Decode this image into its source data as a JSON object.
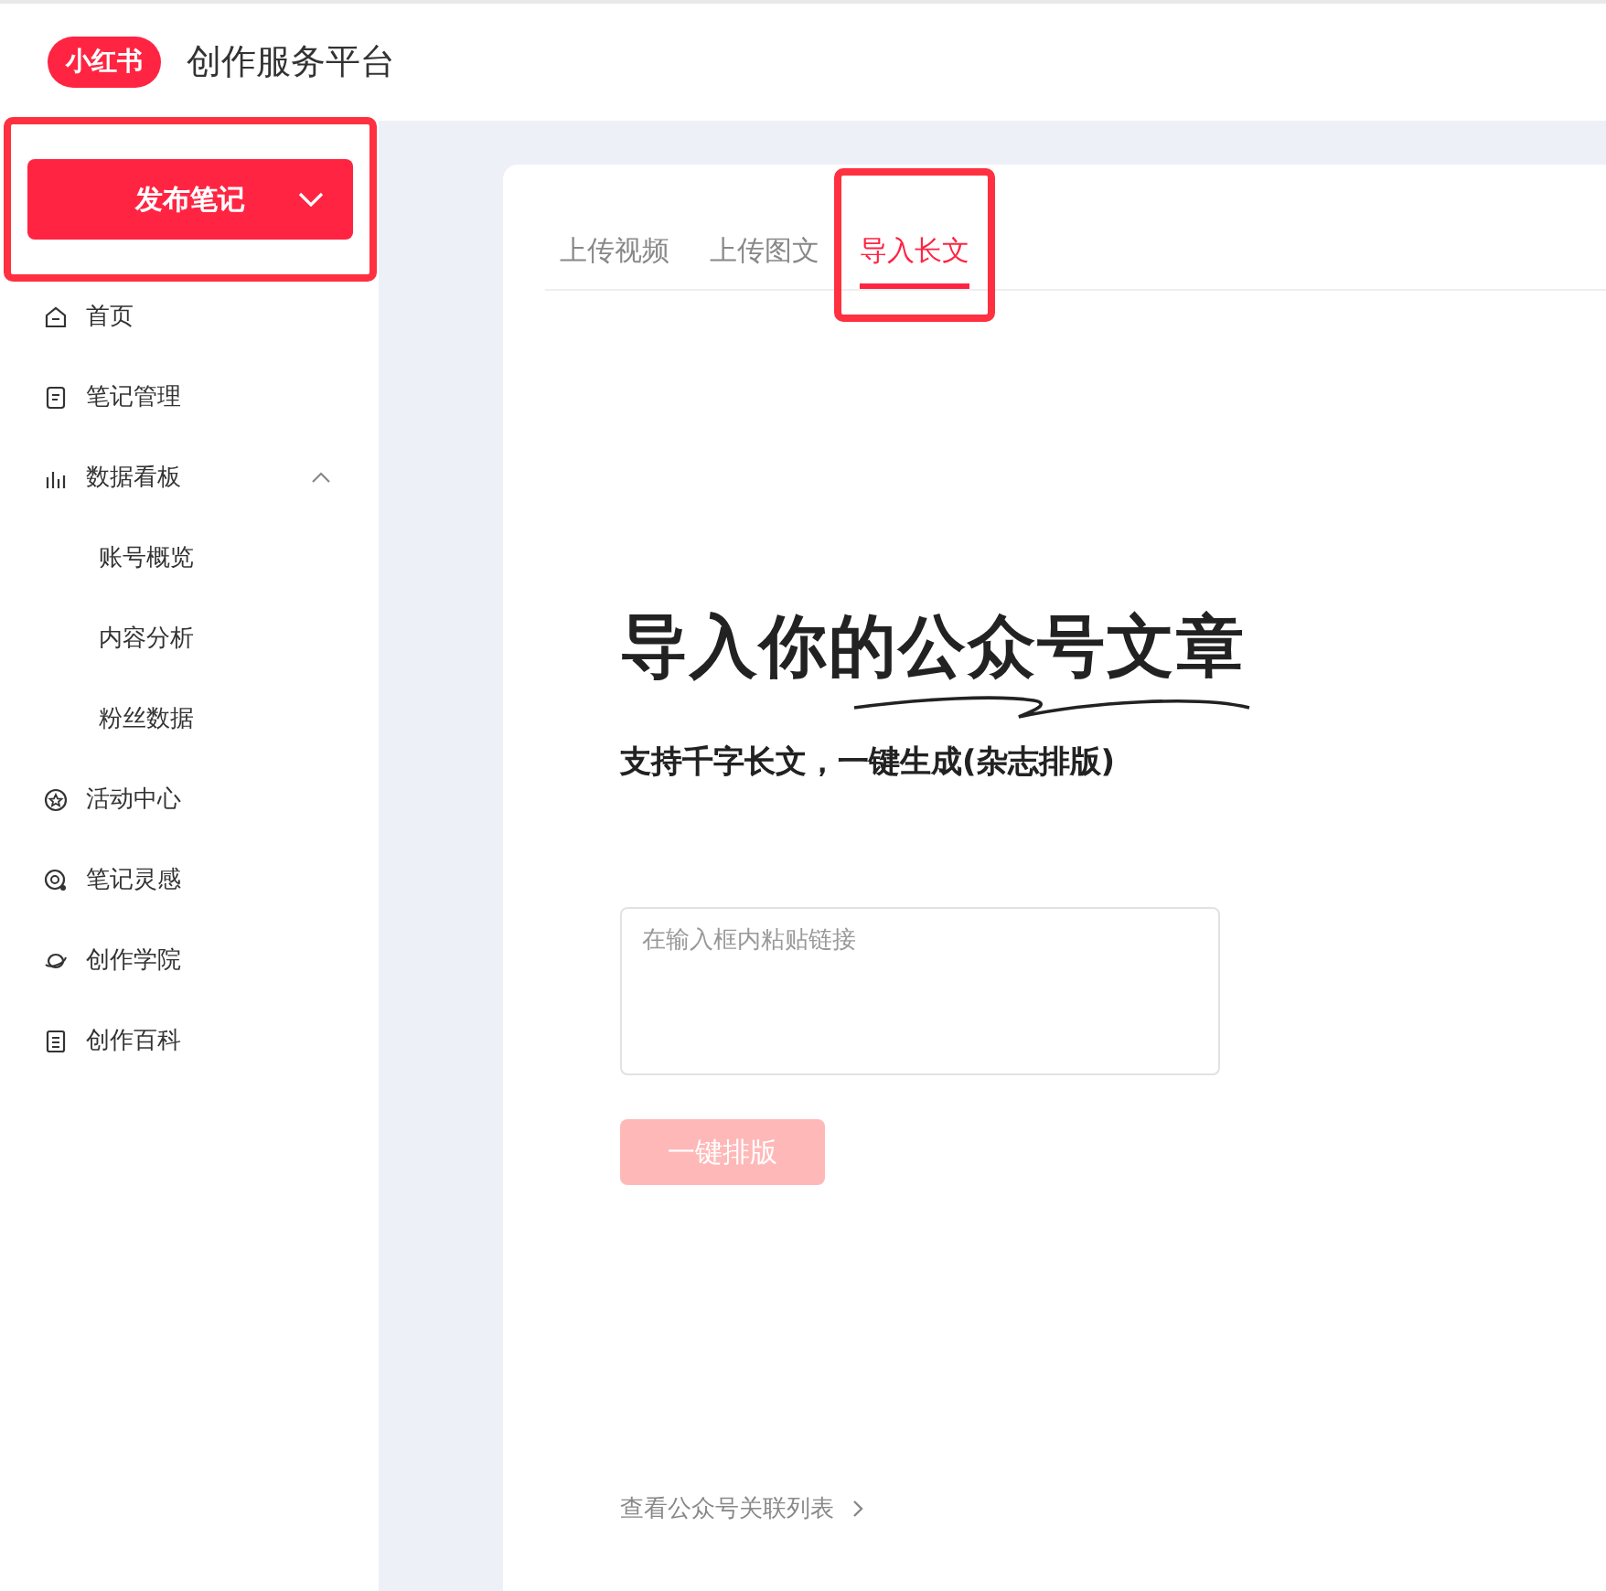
{
  "header": {
    "logo": "小红书",
    "title": "创作服务平台"
  },
  "publish_button": {
    "label": "发布笔记",
    "highlighted": true
  },
  "sidebar": {
    "items": [
      {
        "label": "首页",
        "kind": "home"
      },
      {
        "label": "笔记管理",
        "kind": "note"
      },
      {
        "label": "数据看板",
        "kind": "chart",
        "expanded": true,
        "children": [
          {
            "label": "账号概览"
          },
          {
            "label": "内容分析"
          },
          {
            "label": "粉丝数据"
          }
        ]
      },
      {
        "label": "活动中心",
        "kind": "badge"
      },
      {
        "label": "笔记灵感",
        "kind": "idea"
      },
      {
        "label": "创作学院",
        "kind": "planet"
      },
      {
        "label": "创作百科",
        "kind": "book"
      }
    ]
  },
  "tabs": [
    {
      "label": "上传视频",
      "selected": false,
      "highlighted": false
    },
    {
      "label": "上传图文",
      "selected": false,
      "highlighted": false
    },
    {
      "label": "导入长文",
      "selected": true,
      "highlighted": true
    }
  ],
  "headline": "导入你的公众号文章",
  "subtitle": "支持千字长文，一键生成(杂志排版)",
  "link_input": {
    "placeholder": "在输入框内粘贴链接"
  },
  "format_button": {
    "label": "一键排版",
    "disabled": true
  },
  "list_link": {
    "label": "查看公众号关联列表"
  }
}
